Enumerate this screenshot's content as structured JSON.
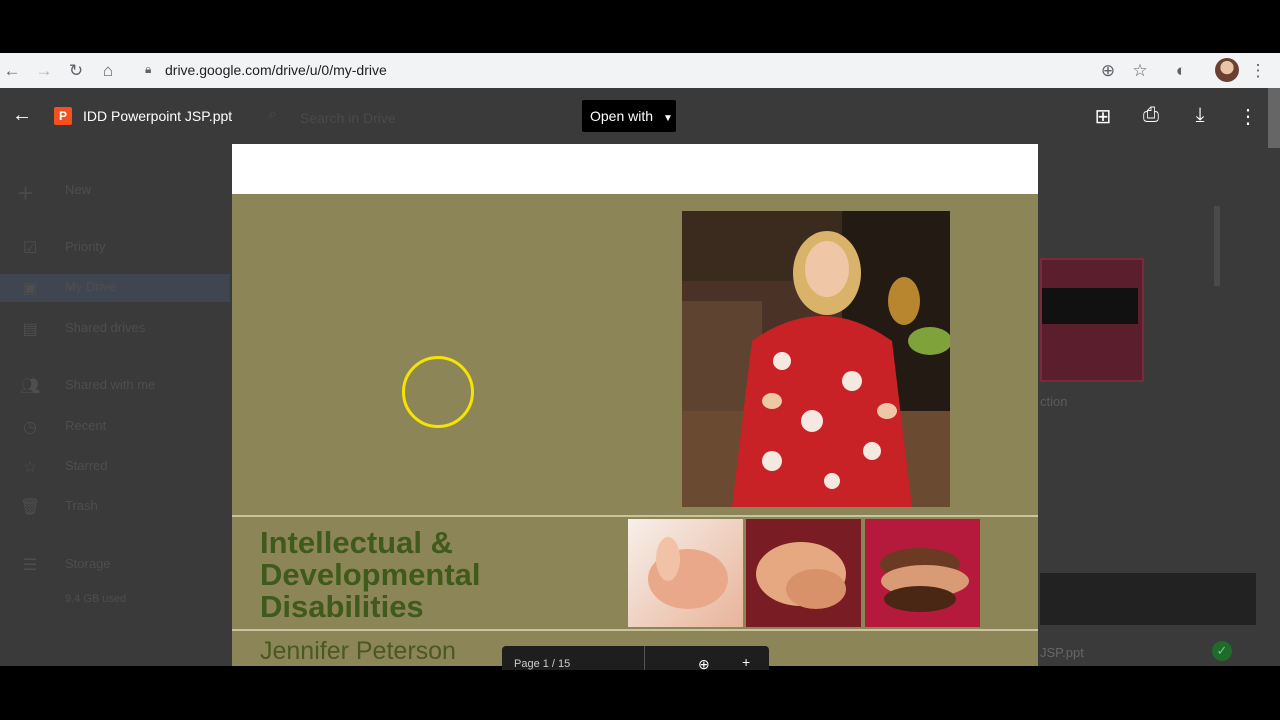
{
  "browser": {
    "url": "drive.google.com/drive/u/0/my-drive",
    "icons": [
      "back-icon",
      "forward-icon",
      "reload-icon",
      "home-icon",
      "lock-icon",
      "add-icon",
      "star-icon",
      "extension-icon",
      "avatar",
      "menu-icon"
    ]
  },
  "viewer": {
    "filename": "IDD Powerpoint JSP.ppt",
    "file_type_badge": "P",
    "open_with_label": "Open with",
    "page_indicator": "Page 1 / 15"
  },
  "drive_sidebar": {
    "new_label": "New",
    "items": [
      {
        "label": "Priority"
      },
      {
        "label": "My Drive"
      },
      {
        "label": "Shared drives"
      },
      {
        "label": "Shared with me"
      },
      {
        "label": "Recent"
      },
      {
        "label": "Starred"
      },
      {
        "label": "Trash"
      },
      {
        "label": "Storage"
      }
    ],
    "storage_used": "9.4 GB used",
    "search_placeholder": "Search in Drive"
  },
  "background_fragments": {
    "section_label": "ction",
    "file_label": "JSP.ppt"
  },
  "slide": {
    "title_lines": [
      "Intellectual &",
      "Developmental",
      "Disabilities"
    ],
    "author": "Jennifer Peterson"
  },
  "colors": {
    "slide_bg": "#8c8558",
    "title_text": "#3f5a1a",
    "ppt_badge": "#f4511e",
    "cursor_ring": "#f5e400"
  }
}
